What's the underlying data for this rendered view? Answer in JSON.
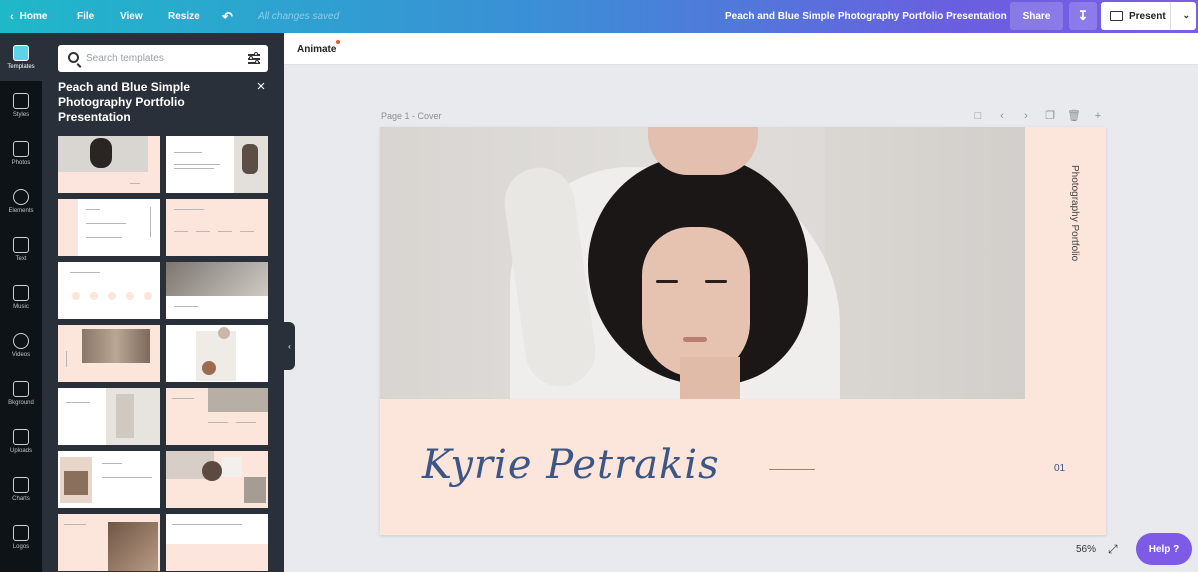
{
  "topbar": {
    "home": "Home",
    "file": "File",
    "view": "View",
    "resize": "Resize",
    "undo_icon": "undo-icon",
    "saved_status": "All changes saved",
    "doc_title": "Peach and Blue Simple Photography Portfolio Presentation",
    "share": "Share",
    "present": "Present"
  },
  "rail": {
    "items": [
      {
        "label": "Templates",
        "icon": "templates-icon"
      },
      {
        "label": "Styles",
        "icon": "styles-icon"
      },
      {
        "label": "Photos",
        "icon": "photos-icon"
      },
      {
        "label": "Elements",
        "icon": "elements-icon"
      },
      {
        "label": "Text",
        "icon": "text-icon"
      },
      {
        "label": "Music",
        "icon": "music-icon"
      },
      {
        "label": "Videos",
        "icon": "videos-icon"
      },
      {
        "label": "Bkground",
        "icon": "background-icon"
      },
      {
        "label": "Uploads",
        "icon": "uploads-icon"
      },
      {
        "label": "Charts",
        "icon": "charts-icon"
      },
      {
        "label": "Logos",
        "icon": "logos-icon"
      }
    ]
  },
  "panel": {
    "search_placeholder": "Search templates",
    "title": "Peach and Blue Simple Photography Portfolio Presentation"
  },
  "editor": {
    "animate": "Animate",
    "page_label": "Page 1 - Cover",
    "vertical_text": "Photography Portfolio",
    "name": "Kyrie Petrakis",
    "page_number": "01",
    "zoom": "56%",
    "help": "Help ?"
  },
  "colors": {
    "peach": "#fce6dc",
    "navy_script": "#3e5684",
    "help_purple": "#7d5be6"
  }
}
